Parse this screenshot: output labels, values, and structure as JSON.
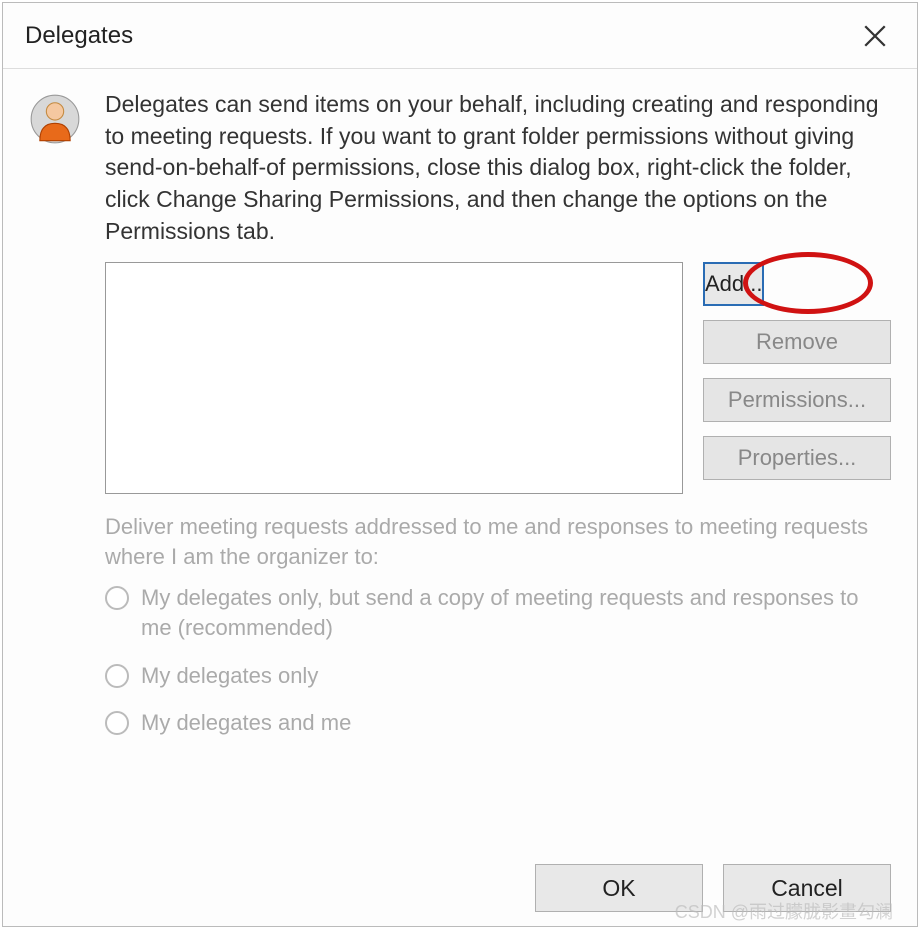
{
  "dialog": {
    "title": "Delegates",
    "description": "Delegates can send items on your behalf, including creating and responding to meeting requests. If you want to grant folder permissions without giving send-on-behalf-of permissions, close this dialog box, right-click the folder, click Change Sharing Permissions, and then change the options on the Permissions tab.",
    "buttons": {
      "add": "Add...",
      "remove": "Remove",
      "permissions": "Permissions...",
      "properties": "Properties..."
    },
    "deliver_label": "Deliver meeting requests addressed to me and responses to meeting requests where I am the organizer to:",
    "radios": {
      "opt1": "My delegates only, but send a copy of meeting requests and responses to me (recommended)",
      "opt2": "My delegates only",
      "opt3": "My delegates and me"
    },
    "footer": {
      "ok": "OK",
      "cancel": "Cancel"
    }
  },
  "watermark": "CSDN @雨过朦胧影畫勾澜"
}
